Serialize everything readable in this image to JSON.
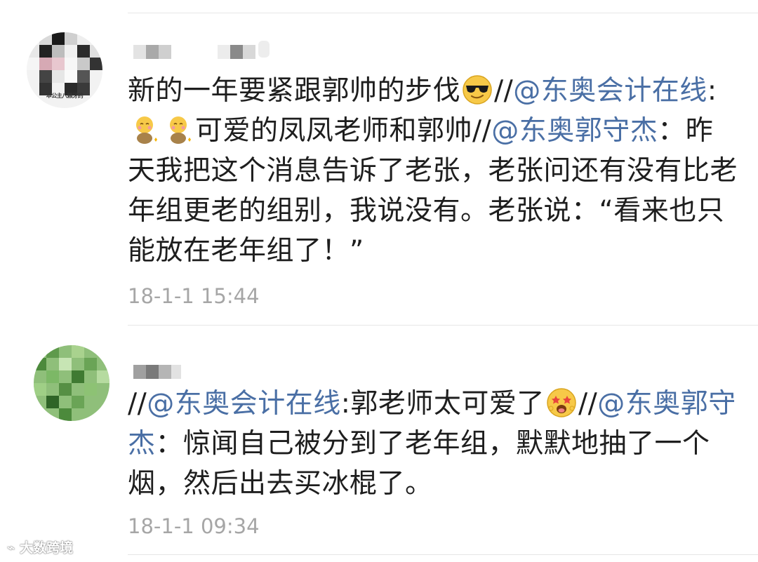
{
  "comments": [
    {
      "username": "",
      "avatar_caption": "本公主八颗牙的",
      "text_parts": [
        "新的一年要紧跟郭帅的步伐",
        "//",
        "@东奥会计在线",
        ":",
        "可爱的凤凤老师和郭帅//",
        "@东奥郭守杰",
        "：昨天我把这个消息告诉了老张，老张问还有没有比老年组更老的组别，我说没有。老张说：“看来也只能放在老年组了！”"
      ],
      "emojis": [
        "sunglasses-emoji",
        "shy-sitting-emoji",
        "shy-sitting-emoji"
      ],
      "timestamp": "18-1-1 15:44"
    },
    {
      "username": "",
      "text_parts": [
        "//",
        "@东奥会计在线",
        ":郭老师太可爱了",
        "//",
        "@东奥郭守杰",
        "：惊闻自己被分到了老年组，默默地抽了一个烟，然后出去买冰棍了。"
      ],
      "emojis": [
        "starstruck-emoji"
      ],
      "timestamp": "18-1-1 09:34"
    }
  ],
  "watermark": "大数跨境",
  "colors": {
    "mention": "#4a6fa5",
    "timestamp": "#a6a6a6",
    "text": "#1e1e1e"
  }
}
